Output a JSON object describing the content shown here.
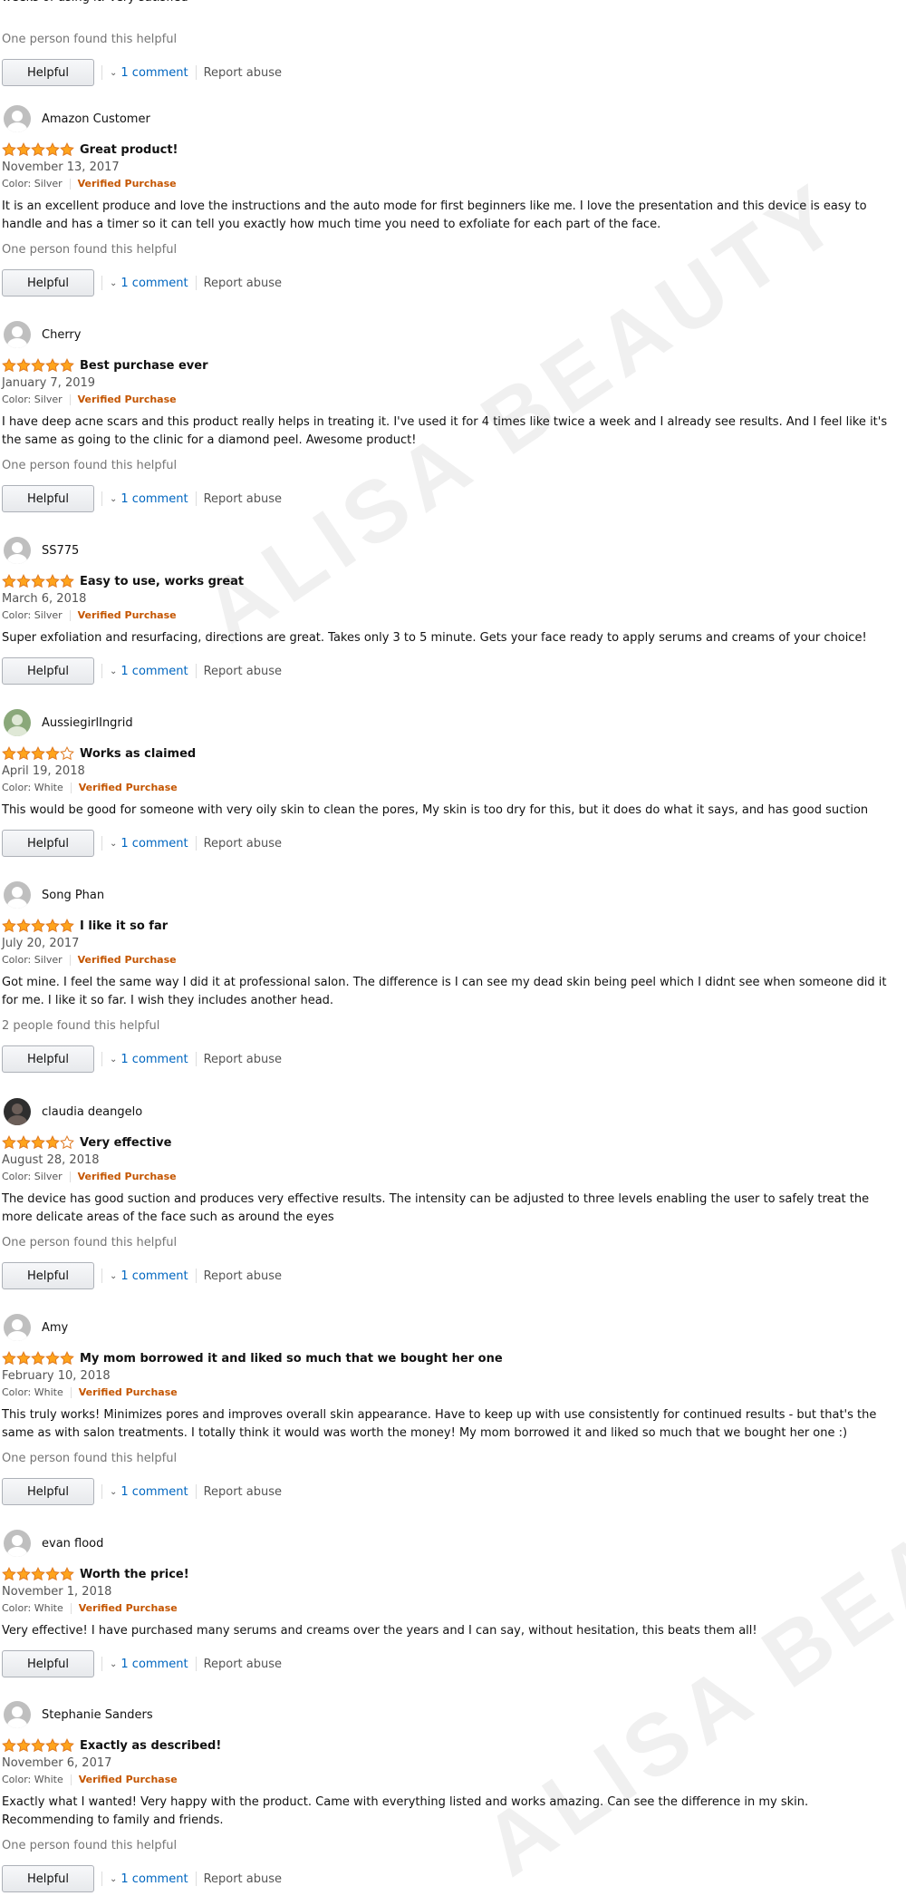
{
  "watermark": "ALISA BEAUTY",
  "partial_review": {
    "body": "weeks of using it. Very satisfied",
    "helpful_text": "One person found this helpful",
    "helpful_label": "Helpful",
    "comment_label": "1 comment",
    "report_label": "Report abuse"
  },
  "labels": {
    "helpful": "Helpful",
    "comment": "1 comment",
    "report": "Report abuse",
    "verified": "Verified Purchase"
  },
  "reviews": [
    {
      "name": "Amazon Customer",
      "avatar": "default",
      "rating": 5,
      "title": "Great product!",
      "date": "November 13, 2017",
      "color": "Color: Silver",
      "verified": "Verified Purchase",
      "body": "It is an excellent produce and love the instructions and the auto mode for first beginners like me. I love the presentation and this device is easy to handle and has a timer so it can tell you exactly how much time you need to exfoliate for each part of the face.",
      "helpful_text": "One person found this helpful"
    },
    {
      "name": "Cherry",
      "avatar": "default",
      "rating": 5,
      "title": "Best purchase ever",
      "date": "January 7, 2019",
      "color": "Color: Silver",
      "verified": "Verified Purchase",
      "body": "I have deep acne scars and this product really helps in treating it. I've used it for 4 times like twice a week and I already see results. And I feel like it's the same as going to the clinic for a diamond peel. Awesome product!",
      "helpful_text": "One person found this helpful"
    },
    {
      "name": "SS775",
      "avatar": "default",
      "rating": 5,
      "title": "Easy to use, works great",
      "date": "March 6, 2018",
      "color": "Color: Silver",
      "verified": "Verified Purchase",
      "body": "Super exfoliation and resurfacing, directions are great. Takes only 3 to 5 minute. Gets your face ready to apply serums and creams of your choice!",
      "helpful_text": ""
    },
    {
      "name": "AussiegirlIngrid",
      "avatar": "green",
      "rating": 4,
      "title": "Works as claimed",
      "date": "April 19, 2018",
      "color": "Color: White",
      "verified": "Verified Purchase",
      "body": "This would be good for someone with very oily skin to clean the pores, My skin is too dry for this, but it does do what it says, and has good suction",
      "helpful_text": ""
    },
    {
      "name": "Song Phan",
      "avatar": "default",
      "rating": 5,
      "title": "I like it so far",
      "date": "July 20, 2017",
      "color": "Color: Silver",
      "verified": "Verified Purchase",
      "body": "Got mine. I feel the same way I did it at professional salon. The difference is I can see my dead skin being peel which I didnt see when someone did it for me. I like it so far. I wish they includes another head.",
      "helpful_text": "2 people found this helpful"
    },
    {
      "name": "claudia deangelo",
      "avatar": "dark",
      "rating": 4,
      "title": "Very effective",
      "date": "August 28, 2018",
      "color": "Color: Silver",
      "verified": "Verified Purchase",
      "body": "The device has good suction and produces very effective results. The intensity can be adjusted to three levels enabling the user to safely treat the more delicate areas of the face such as around the eyes",
      "helpful_text": "One person found this helpful"
    },
    {
      "name": "Amy",
      "avatar": "default",
      "rating": 5,
      "title": "My mom borrowed it and liked so much that we bought her one",
      "date": "February 10, 2018",
      "color": "Color: White",
      "verified": "Verified Purchase",
      "body": "This truly works! Minimizes pores and improves overall skin appearance. Have to keep up with use consistently for continued results - but that's the same as with salon treatments. I totally think it would was worth the money! My mom borrowed it and liked so much that we bought her one :)",
      "helpful_text": "One person found this helpful"
    },
    {
      "name": "evan flood",
      "avatar": "default",
      "rating": 5,
      "title": "Worth the price!",
      "date": "November 1, 2018",
      "color": "Color: White",
      "verified": "Verified Purchase",
      "body": "Very effective! I have purchased many serums and creams over the years and I can say, without hesitation, this beats them all!",
      "helpful_text": ""
    },
    {
      "name": "Stephanie Sanders",
      "avatar": "default",
      "rating": 5,
      "title": "Exactly as described!",
      "date": "November 6, 2017",
      "color": "Color: White",
      "verified": "Verified Purchase",
      "body": "Exactly what I wanted! Very happy with the product. Came with everything listed and works amazing. Can see the difference in my skin. Recommending to family and friends.",
      "helpful_text": "One person found this helpful"
    }
  ]
}
